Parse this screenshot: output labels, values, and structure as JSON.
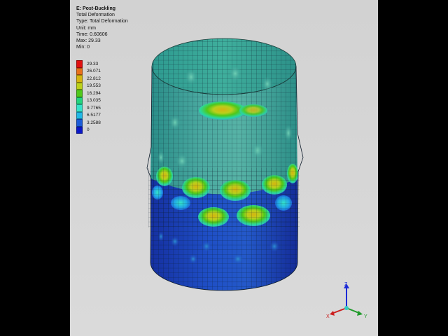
{
  "result": {
    "title": "E: Post-Buckling",
    "name": "Total Deformation",
    "type_line": "Type: Total Deformation",
    "unit_line": "Unit: mm",
    "time_line": "Time: 0.60606",
    "max_line": "Max: 29.33",
    "min_line": "Min: 0"
  },
  "legend": {
    "entries": [
      {
        "label": "29.33",
        "color": "#e01010"
      },
      {
        "label": "26.071",
        "color": "#e8701a"
      },
      {
        "label": "22.812",
        "color": "#d6b510"
      },
      {
        "label": "19.553",
        "color": "#bcd11a"
      },
      {
        "label": "16.294",
        "color": "#4fc81a"
      },
      {
        "label": "13.035",
        "color": "#22d47e"
      },
      {
        "label": "9.7765",
        "color": "#35e3c8"
      },
      {
        "label": "6.5177",
        "color": "#21b8e6"
      },
      {
        "label": "3.2588",
        "color": "#1b5cd8"
      },
      {
        "label": "0",
        "color": "#0a17c8"
      }
    ]
  },
  "triad": {
    "z_label": "Z",
    "x_label": "X",
    "y_label": "Y",
    "z_color": "#1c2bd6",
    "x_color": "#cc1f1f",
    "y_color": "#1f9a2a"
  }
}
